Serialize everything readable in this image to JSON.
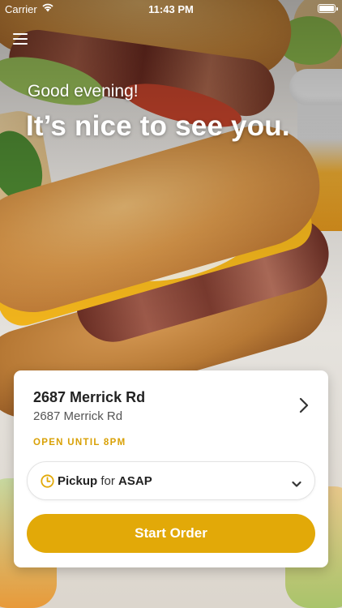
{
  "status_bar": {
    "carrier": "Carrier",
    "time": "11:43 PM",
    "icons": [
      "wifi-icon",
      "battery-icon"
    ]
  },
  "header": {
    "menu_icon": "hamburger-menu-icon",
    "greeting": "Good evening!",
    "headline": "It’s nice to see you."
  },
  "store": {
    "name": "2687 Merrick Rd",
    "address": "2687 Merrick Rd",
    "hours_status": "OPEN UNTIL 8PM",
    "chevron_icon": "chevron-right-icon"
  },
  "order_mode": {
    "icon": "clock-icon",
    "mode": "Pickup",
    "connector": " for ",
    "time": "ASAP",
    "chevron_icon": "chevron-down-icon"
  },
  "actions": {
    "start_order_label": "Start Order"
  },
  "colors": {
    "accent": "#e2a908",
    "hours_text": "#d9a106",
    "card_background": "#ffffff"
  }
}
